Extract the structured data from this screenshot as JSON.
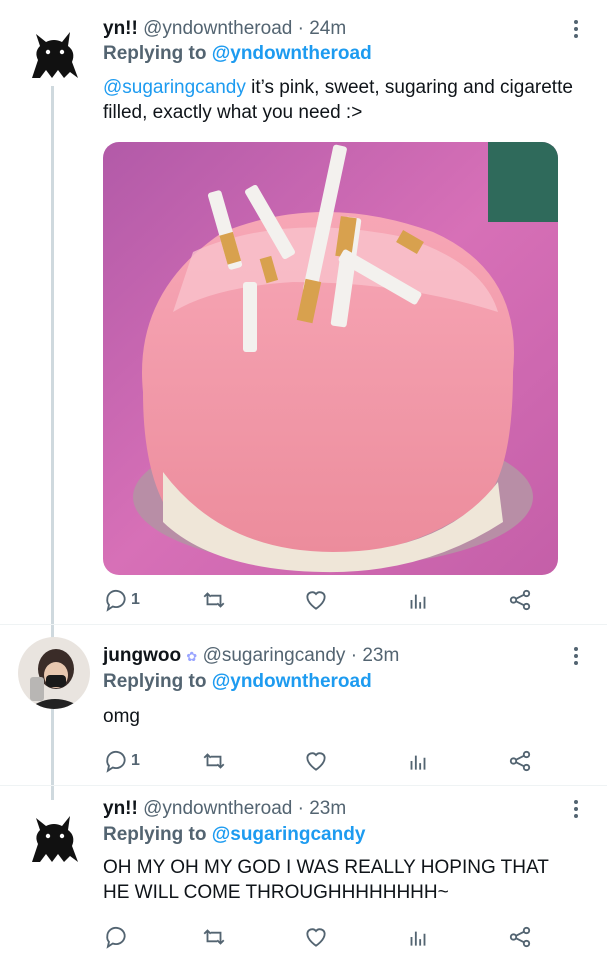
{
  "tweets": [
    {
      "display_name": "yn!!",
      "handle": "@yndowntheroad",
      "separator": "·",
      "time": "24m",
      "reply_label": "Replying to",
      "reply_to": "@yndowntheroad",
      "mention": "@sugaringcandy",
      "text": " it’s pink, sweet, sugaring and cigarette filled, exactly what you need :>",
      "reply_count": "1",
      "avatar": "black-cat-icon"
    },
    {
      "display_name": "jungwoo",
      "handle": "@sugaringcandy",
      "separator": "·",
      "time": "23m",
      "reply_label": "Replying to",
      "reply_to": "@yndowntheroad",
      "text": "omg",
      "reply_count": "1",
      "avatar": "profile-photo"
    },
    {
      "display_name": "yn!!",
      "handle": "@yndowntheroad",
      "separator": "·",
      "time": "23m",
      "reply_label": "Replying to",
      "reply_to": "@sugaringcandy",
      "text": "OH MY OH MY GOD I WAS REALLY HOPING THAT HE WILL COME THROUGHHHHHHHH~",
      "reply_count": "",
      "avatar": "black-cat-icon"
    }
  ],
  "colors": {
    "link": "#1d9bf0",
    "secondary": "#536471",
    "text": "#0f1419",
    "thread_line": "#cfd9de"
  },
  "icons": [
    "reply-icon",
    "retweet-icon",
    "like-icon",
    "views-icon",
    "share-icon",
    "more-icon"
  ]
}
